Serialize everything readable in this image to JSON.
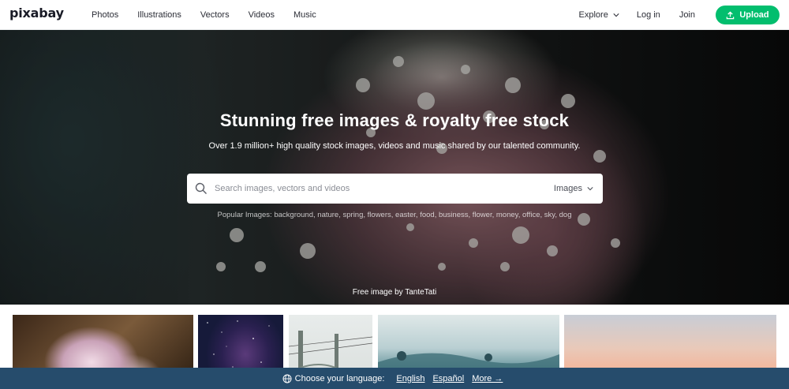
{
  "header": {
    "logo": "pixabay",
    "nav": [
      "Photos",
      "Illustrations",
      "Vectors",
      "Videos",
      "Music"
    ],
    "explore": "Explore",
    "login": "Log in",
    "join": "Join",
    "upload": "Upload"
  },
  "hero": {
    "title": "Stunning free images & royalty free stock",
    "subtitle": "Over 1.9 million+ high quality stock images, videos and music shared by our talented community.",
    "search": {
      "placeholder": "Search images, vectors and videos",
      "value": "",
      "type": "Images"
    },
    "popular": {
      "label": "Popular Images:",
      "tags": [
        "background",
        "nature",
        "spring",
        "flowers",
        "easter",
        "food",
        "business",
        "flower",
        "money",
        "office",
        "sky",
        "dog"
      ]
    },
    "credit": "Free image by TanteTati"
  },
  "gallery": {
    "thumbnail_count": 5
  },
  "language_bar": {
    "prompt": "Choose your language:",
    "options": [
      "English",
      "Español"
    ],
    "more": "More →"
  },
  "colors": {
    "accent": "#02be6e",
    "language_bar": "#264c6c"
  },
  "icons": [
    "search-icon",
    "chevron-down-icon",
    "upload-icon",
    "globe-icon"
  ]
}
